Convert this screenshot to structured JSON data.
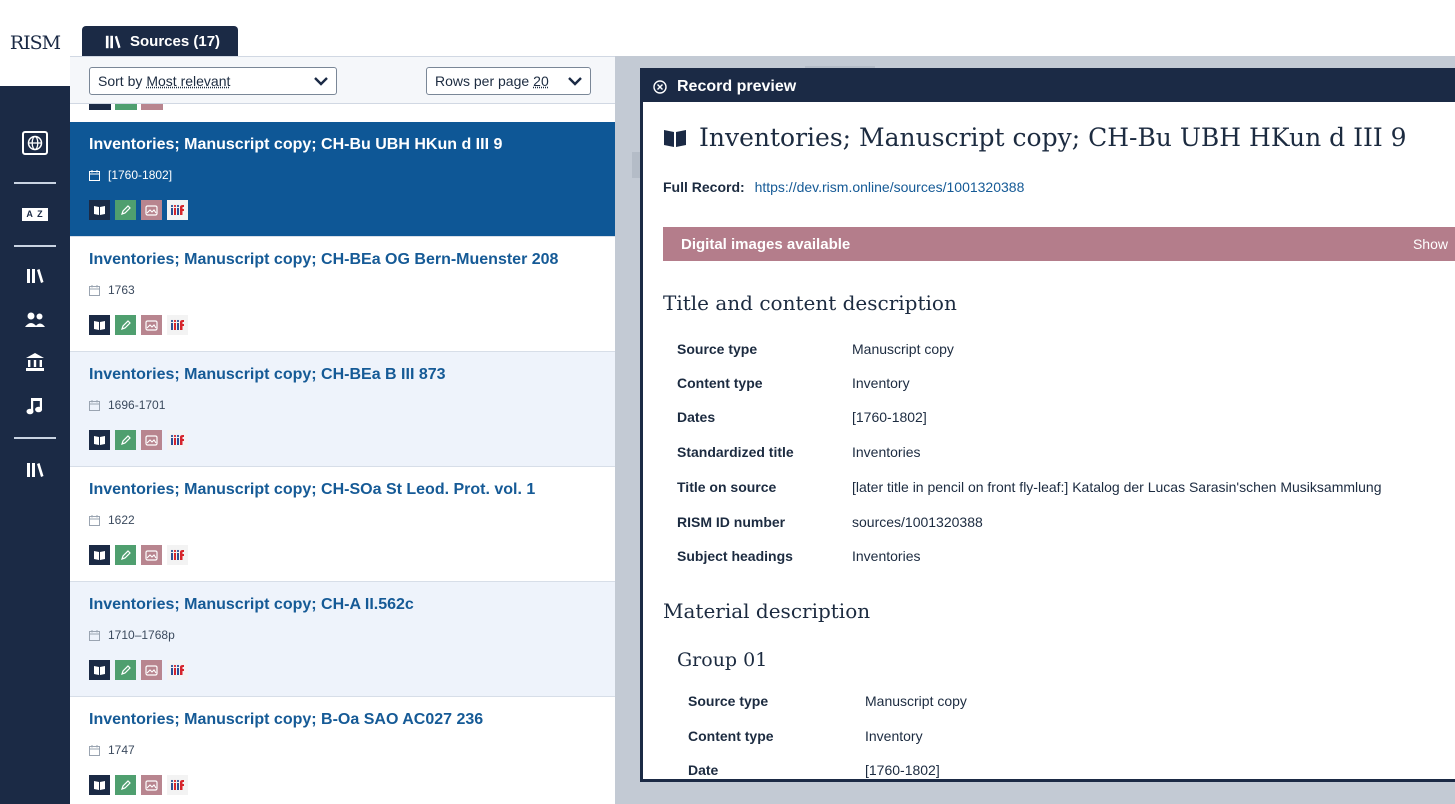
{
  "rail": {
    "logo": "RISM",
    "icons": [
      "globe-icon",
      "az-icon",
      "sources-icon",
      "people-icon",
      "institutions-icon",
      "music-incipit-icon",
      "sources-icon"
    ]
  },
  "tab": {
    "label": "Sources (17)"
  },
  "controls": {
    "sort_label": "Sort by",
    "sort_value": "Most relevant",
    "rows_label": "Rows per page",
    "rows_value": "20"
  },
  "results": [
    {
      "title": "Inventories; Manuscript copy; CH-Bu UBH HKun d III 9",
      "date": "[1760-1802]",
      "selected": true
    },
    {
      "title": "Inventories; Manuscript copy; CH-BEa OG Bern-Muenster 208",
      "date": "1763"
    },
    {
      "title": "Inventories; Manuscript copy; CH-BEa B III 873",
      "date": "1696-1701"
    },
    {
      "title": "Inventories; Manuscript copy; CH-SOa St Leod. Prot. vol. 1",
      "date": "1622"
    },
    {
      "title": "Inventories; Manuscript copy; CH-A II.562c",
      "date": "1710–1768p"
    },
    {
      "title": "Inventories; Manuscript copy; B-Oa SAO AC027 236",
      "date": "1747"
    }
  ],
  "badges": {
    "iiif": "iiif"
  },
  "preview": {
    "header": "Record preview",
    "title": "Inventories; Manuscript copy; CH-Bu UBH HKun d III 9",
    "full_record_label": "Full Record:",
    "full_record_url": "https://dev.rism.online/sources/1001320388",
    "digital_images": "Digital images available",
    "show": "Show",
    "section1": "Title and content description",
    "fields": [
      {
        "k": "Source type",
        "v": "Manuscript copy"
      },
      {
        "k": "Content type",
        "v": "Inventory"
      },
      {
        "k": "Dates",
        "v": "[1760-1802]"
      },
      {
        "k": "Standardized title",
        "v": "Inventories"
      },
      {
        "k": "Title on source",
        "v": "[later title in pencil on front fly-leaf:] Katalog der Lucas Sarasin'schen Musiksammlung"
      },
      {
        "k": "RISM ID number",
        "v": "sources/1001320388"
      },
      {
        "k": "Subject headings",
        "v": "Inventories"
      }
    ],
    "section2": "Material description",
    "group": "Group 01",
    "group_fields": [
      {
        "k": "Source type",
        "v": "Manuscript copy"
      },
      {
        "k": "Content type",
        "v": "Inventory"
      },
      {
        "k": "Date",
        "v": "[1760-1802]"
      }
    ]
  },
  "colors": {
    "navy": "#1b2a45",
    "selected": "#0e5796",
    "link": "#155a96",
    "digital_bar": "#b47d8b",
    "badge_green": "#4f9f6f",
    "badge_pink": "#b8858f"
  }
}
